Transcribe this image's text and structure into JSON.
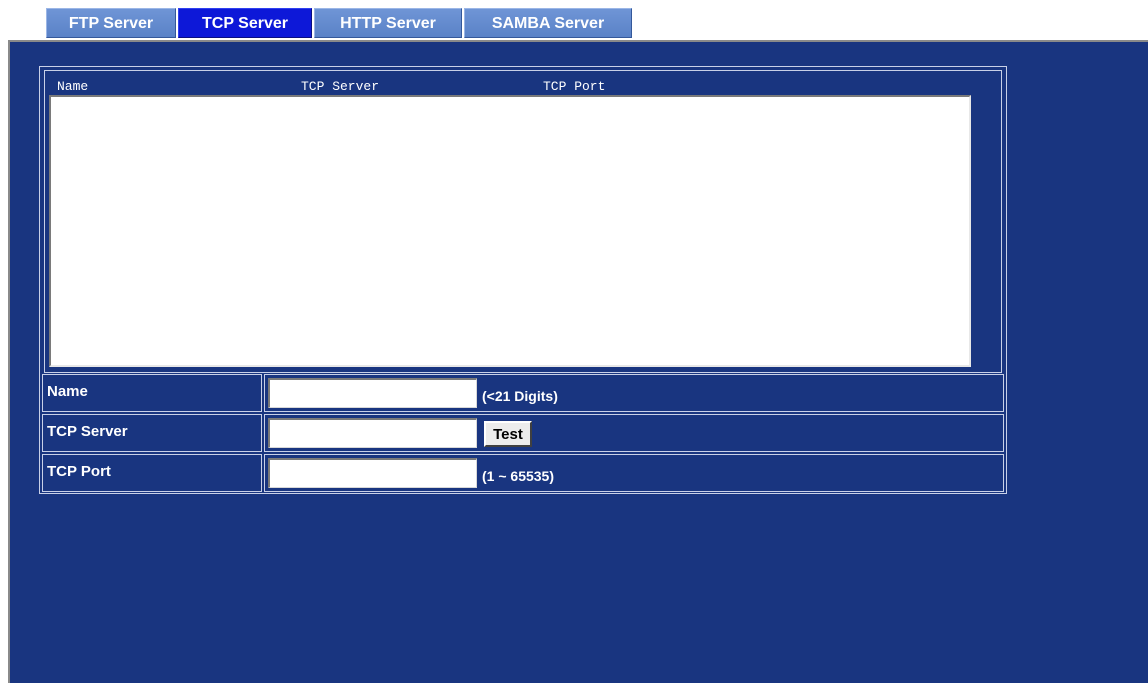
{
  "tabs": [
    {
      "label": "FTP Server",
      "active": false
    },
    {
      "label": "TCP Server",
      "active": true
    },
    {
      "label": "HTTP Server",
      "active": false
    },
    {
      "label": "SAMBA Server",
      "active": false
    }
  ],
  "server_list": {
    "columns": [
      "Name",
      "TCP Server",
      "TCP Port"
    ],
    "rows": []
  },
  "form": {
    "name": {
      "label": "Name",
      "value": "",
      "hint": "(<21 Digits)"
    },
    "tcp_server": {
      "label": "TCP Server",
      "value": "",
      "button_label": "Test"
    },
    "tcp_port": {
      "label": "TCP Port",
      "value": "",
      "hint": "(1 ~ 65535)"
    }
  },
  "colors": {
    "background": "#193580",
    "active_tab": "#0d18d8",
    "inactive_tab": "#5a82c7"
  }
}
